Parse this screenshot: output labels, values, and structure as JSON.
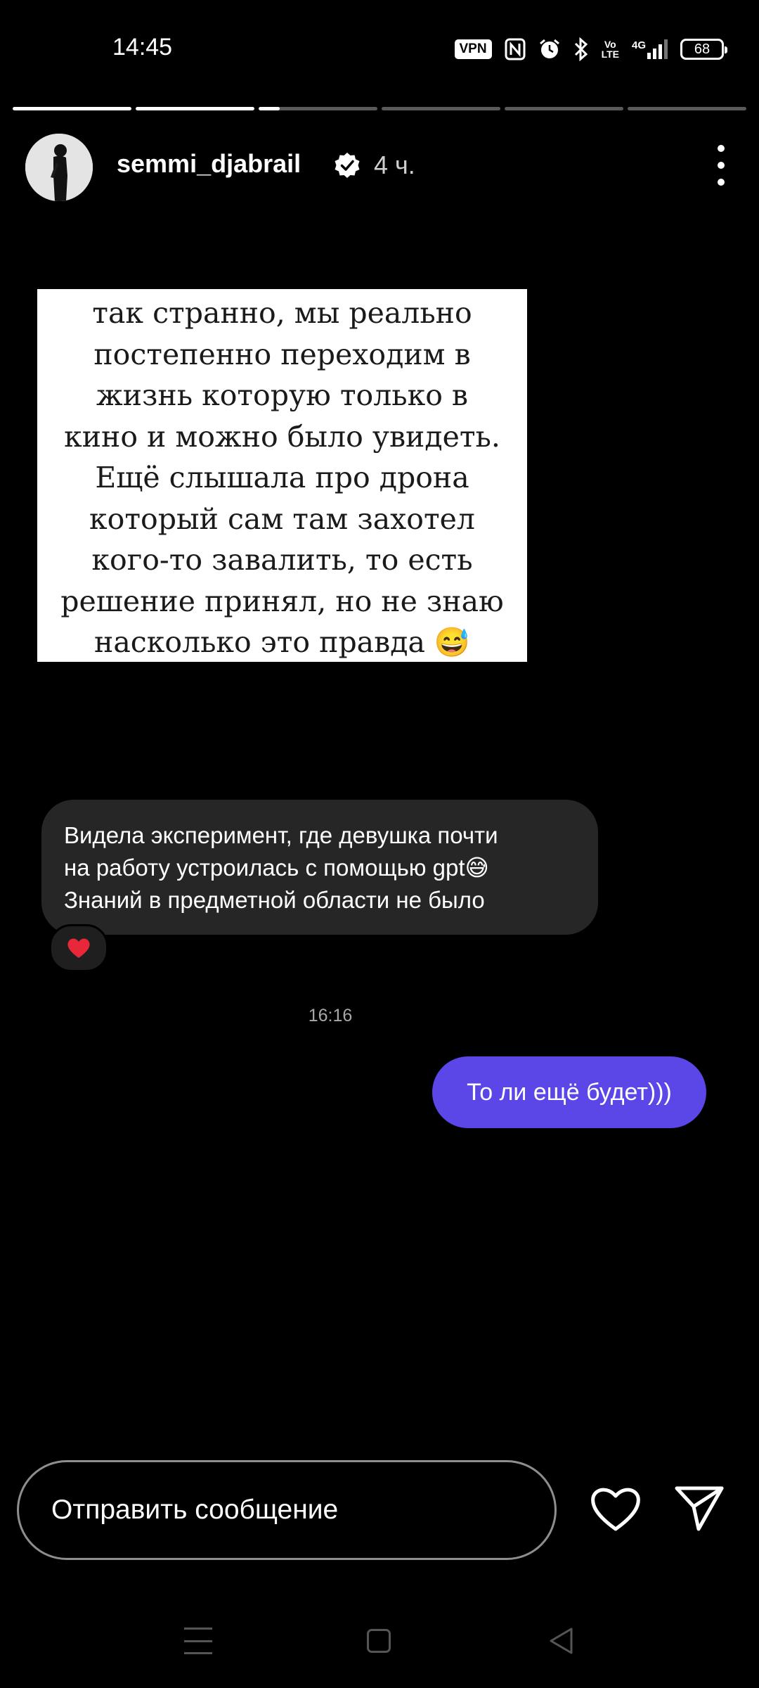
{
  "status_bar": {
    "time": "14:45",
    "vpn": "VPN",
    "net_line1": "Vo",
    "net_line2": "LTE",
    "net_type": "4G",
    "battery": "68",
    "icons": [
      "vpn-badge",
      "nfc-icon",
      "alarm-icon",
      "bluetooth-icon",
      "volte-icon",
      "signal-icon",
      "battery-icon"
    ]
  },
  "story": {
    "segments": 6,
    "active_segment": 3,
    "active_progress": 0.18,
    "username": "semmi_djabrail",
    "time_ago": "4 ч."
  },
  "card": {
    "lines": [
      "так странно, мы реально",
      "постепенно переходим в",
      "жизнь которую только в",
      "кино и можно было увидеть.",
      "Ещё слышала про дрона",
      "который сам там захотел",
      "кого-то завалить, то есть",
      "решение принял, но не знаю",
      "насколько это правда 😅"
    ]
  },
  "messages": {
    "incoming": {
      "line1": "Видела эксперимент, где девушка почти",
      "line2": "на работу устроилась с помощью gpt😅",
      "line3": "Знаний в предметной области не было",
      "reaction": "❤️"
    },
    "timestamp": "16:16",
    "outgoing": "То ли ещё будет)))"
  },
  "reply_bar": {
    "placeholder": "Отправить сообщение"
  },
  "colors": {
    "background": "#000000",
    "incoming_bubble": "#262626",
    "outgoing_bubble": "#5b46e8"
  }
}
